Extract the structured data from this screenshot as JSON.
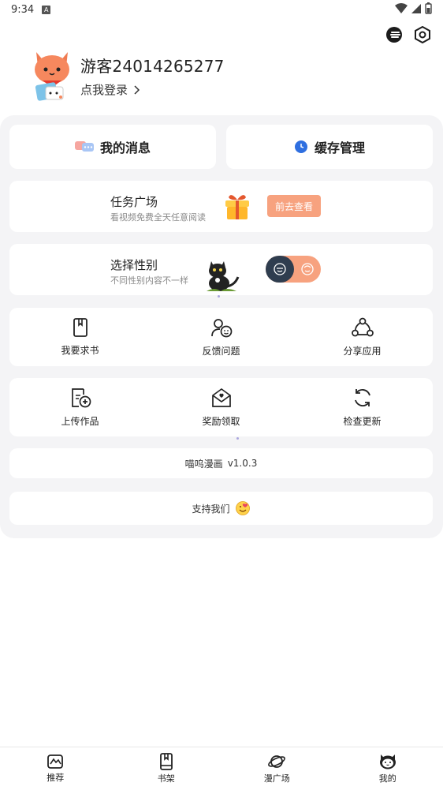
{
  "status_bar": {
    "time": "9:34",
    "notification_letter": "A"
  },
  "header": {
    "icons": [
      "user-theme-icon",
      "settings-icon"
    ]
  },
  "profile": {
    "username": "游客24014265277",
    "login_label": "点我登录"
  },
  "quick_actions": {
    "messages_label": "我的消息",
    "cache_label": "缓存管理"
  },
  "task_card": {
    "title": "任务广场",
    "subtitle": "看视频免费全天任意阅读",
    "button_label": "前去查看"
  },
  "gender_card": {
    "title": "选择性别",
    "subtitle": "不同性别内容不一样"
  },
  "grid_row_1": [
    {
      "label": "我要求书",
      "icon": "book-icon"
    },
    {
      "label": "反馈问题",
      "icon": "feedback-icon"
    },
    {
      "label": "分享应用",
      "icon": "share-icon"
    }
  ],
  "grid_row_2": [
    {
      "label": "上传作品",
      "icon": "upload-icon"
    },
    {
      "label": "奖励领取",
      "icon": "reward-icon"
    },
    {
      "label": "检查更新",
      "icon": "refresh-icon"
    }
  ],
  "version": {
    "app_name": "喵呜漫画",
    "version": "v1.0.3"
  },
  "support": {
    "label": "支持我们"
  },
  "tabbar": [
    {
      "label": "推荐",
      "icon": "recommend-icon"
    },
    {
      "label": "书架",
      "icon": "bookshelf-icon"
    },
    {
      "label": "漫广场",
      "icon": "planet-icon"
    },
    {
      "label": "我的",
      "icon": "cat-face-icon"
    }
  ],
  "colors": {
    "accent": "#f7a27f",
    "panel": "#f4f4f6",
    "clock_blue": "#2f6fe0"
  }
}
